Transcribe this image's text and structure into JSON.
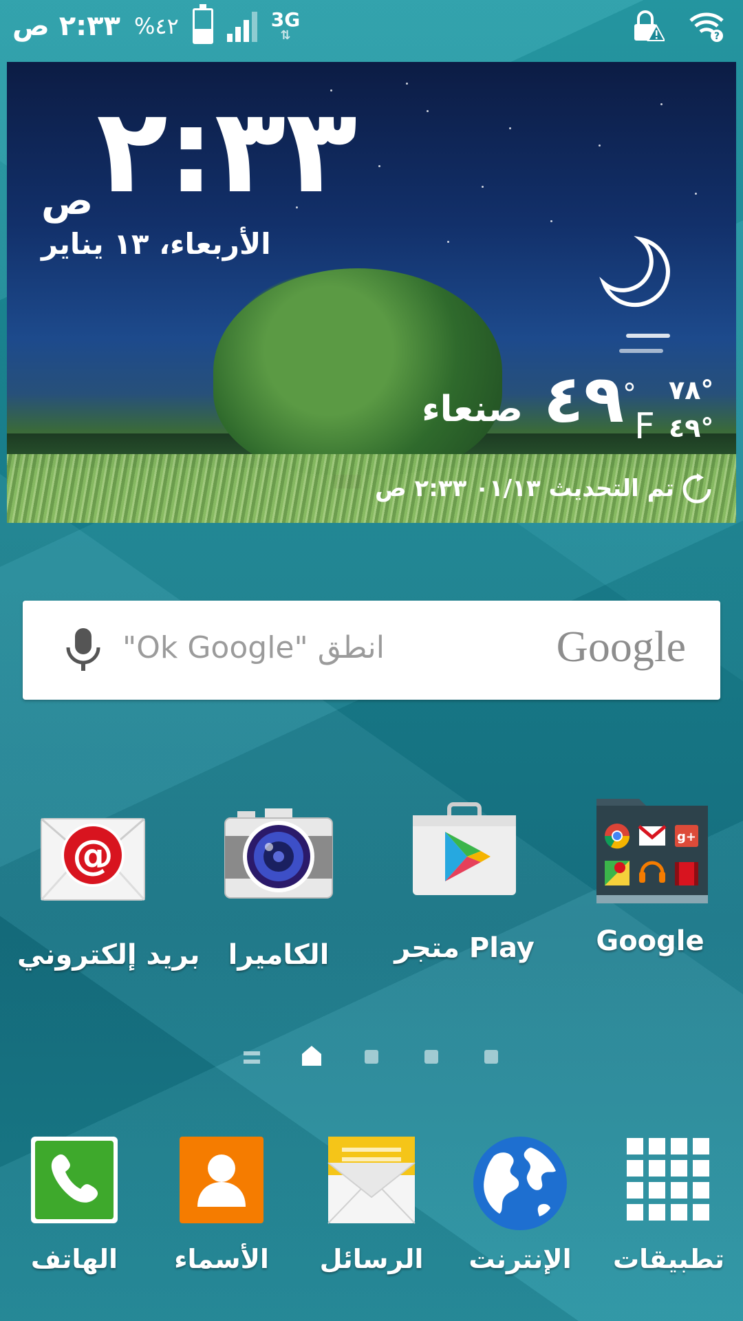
{
  "status_bar": {
    "time": "٢:٣٣ ص",
    "battery_percent": "%٤٢",
    "battery_level": 0.42,
    "network": "3G",
    "icons": [
      "lock-warning-icon",
      "wifi-icon"
    ]
  },
  "weather_widget": {
    "time": "٢:٣٣",
    "ampm": "ص",
    "date": "الأربعاء، ١٣ يناير",
    "temperature": "٤٩",
    "degree_symbol": "°",
    "unit": "F",
    "high": "٧٨°",
    "low": "٤٩°",
    "city": "صنعاء",
    "updated": "تم التحديث ٠١/١٣ ٢:٣٣ ص",
    "condition_icon": "moon-icon"
  },
  "search": {
    "placeholder": "\"Ok Google\" انطق",
    "logo": "Google"
  },
  "apps": [
    {
      "label": "بريد إلكتروني",
      "icon": "email-icon"
    },
    {
      "label": "الكاميرا",
      "icon": "camera-icon"
    },
    {
      "label": "متجر Play",
      "icon": "play-store-icon"
    },
    {
      "label": "Google",
      "icon": "google-folder-icon"
    }
  ],
  "dock": [
    {
      "label": "الهاتف",
      "icon": "phone-icon"
    },
    {
      "label": "الأسماء",
      "icon": "contacts-icon"
    },
    {
      "label": "الرسائل",
      "icon": "messages-icon"
    },
    {
      "label": "الإنترنت",
      "icon": "internet-icon"
    },
    {
      "label": "تطبيقات",
      "icon": "apps-grid-icon"
    }
  ],
  "colors": {
    "wallpaper": "#1a8796",
    "email_red": "#d8141f",
    "phone_green": "#3ea92c",
    "contacts_orange": "#f57c00",
    "messages_yellow": "#f5c518",
    "internet_blue": "#1e6fd0"
  }
}
